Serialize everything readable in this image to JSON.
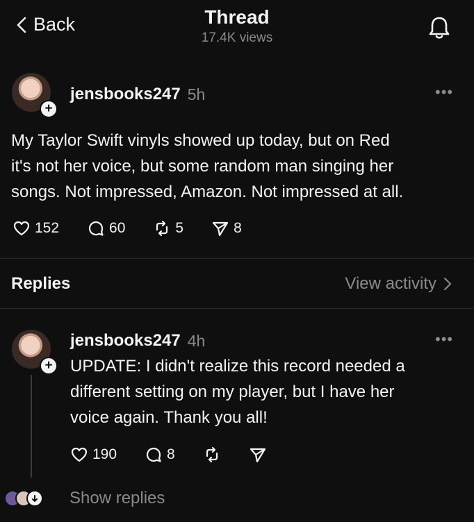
{
  "header": {
    "back_label": "Back",
    "title": "Thread",
    "views": "17.4K views"
  },
  "post": {
    "username": "jensbooks247",
    "time": "5h",
    "text_lines": [
      "My Taylor Swift vinyls showed up today, but on Red",
      "it's not her voice, but some random man singing her",
      "songs. Not impressed, Amazon. Not impressed at all."
    ],
    "likes": "152",
    "comments": "60",
    "reposts": "5",
    "shares": "8"
  },
  "replies_section": {
    "label": "Replies",
    "view_activity": "View activity"
  },
  "reply": {
    "username": "jensbooks247",
    "time": "4h",
    "text_lines": [
      "UPDATE: I didn't realize this record needed a",
      "different setting on my player, but I have her",
      "voice again. Thank you all!"
    ],
    "likes": "190",
    "comments": "8"
  },
  "footer": {
    "show_replies": "Show replies"
  },
  "icons": {
    "back": "chevron-left-icon",
    "notifications": "bell-icon",
    "more": "ellipsis-icon",
    "like": "heart-icon",
    "comment": "comment-bubble-icon",
    "repost": "repost-icon",
    "share": "send-icon",
    "follow": "plus-icon"
  },
  "colors": {
    "background": "#0f0f0f",
    "text": "#f3f3f3",
    "muted": "#8a8a8a"
  }
}
